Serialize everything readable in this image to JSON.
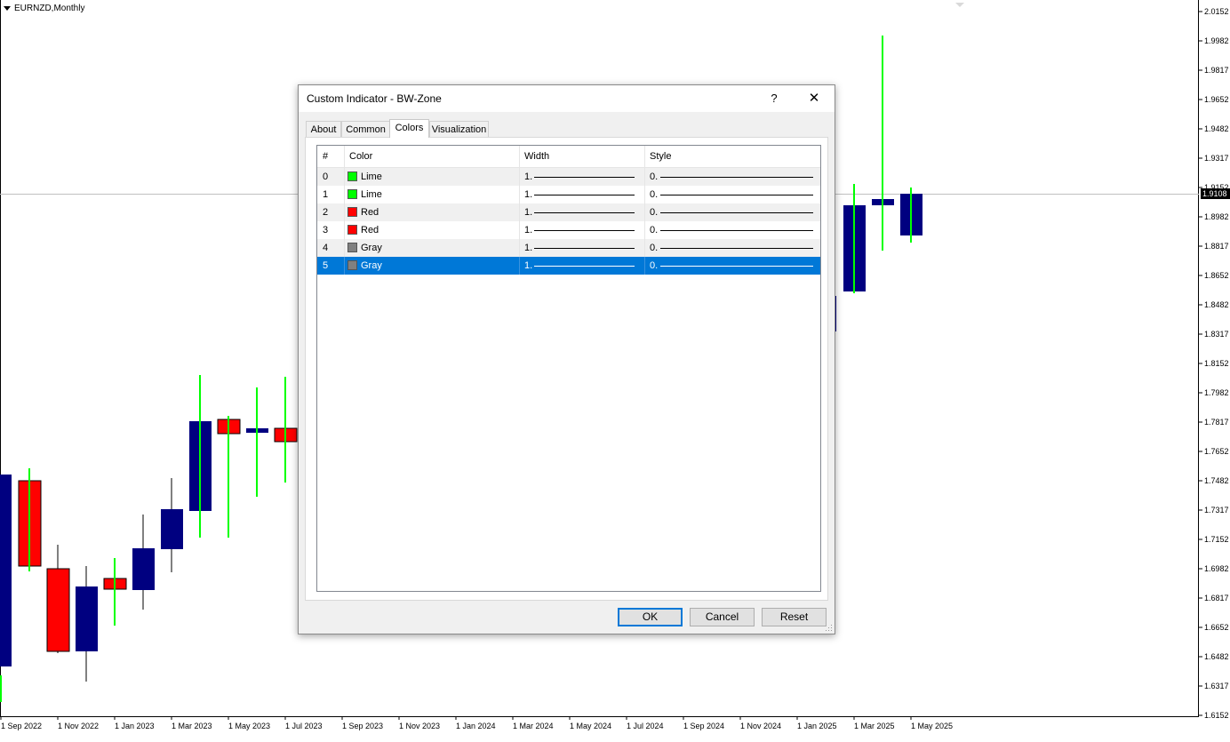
{
  "chart": {
    "symbol": "EURNZD,Monthly",
    "current_price": "1.9108",
    "price_axis": [
      "2.0152",
      "1.9982",
      "1.9817",
      "1.9652",
      "1.9482",
      "1.9317",
      "1.9152",
      "1.8982",
      "1.8817",
      "1.8652",
      "1.8482",
      "1.8317",
      "1.8152",
      "1.7982",
      "1.7817",
      "1.7652",
      "1.7482",
      "1.7317",
      "1.7152",
      "1.6982",
      "1.6817",
      "1.6652",
      "1.6482",
      "1.6317",
      "1.6152"
    ],
    "time_axis": [
      "1 Sep 2022",
      "1 Nov 2022",
      "1 Jan 2023",
      "1 Mar 2023",
      "1 May 2023",
      "1 Jul 2023",
      "1 Sep 2023",
      "1 Nov 2023",
      "1 Jan 2024",
      "1 Mar 2024",
      "1 May 2024",
      "1 Jul 2024",
      "1 Sep 2024",
      "1 Nov 2024",
      "1 Jan 2025",
      "1 Mar 2025",
      "1 May 2025"
    ],
    "colors": {
      "bull": "#000080",
      "bear": "#ff0000",
      "lime": "#00ff00",
      "gray": "#808080",
      "grid_line": "#c0c0c0"
    }
  },
  "dialog": {
    "title": "Custom Indicator - BW-Zone",
    "help_label": "?",
    "close_label": "✕",
    "tabs": [
      "About",
      "Common",
      "Colors",
      "Visualization"
    ],
    "active_tab": "Colors",
    "columns": [
      "#",
      "Color",
      "Width",
      "Style"
    ],
    "rows": [
      {
        "index": "0",
        "color_name": "Lime",
        "color_hex": "#00ff00",
        "width": "1.",
        "style": "0."
      },
      {
        "index": "1",
        "color_name": "Lime",
        "color_hex": "#00ff00",
        "width": "1.",
        "style": "0."
      },
      {
        "index": "2",
        "color_name": "Red",
        "color_hex": "#ff0000",
        "width": "1.",
        "style": "0."
      },
      {
        "index": "3",
        "color_name": "Red",
        "color_hex": "#ff0000",
        "width": "1.",
        "style": "0."
      },
      {
        "index": "4",
        "color_name": "Gray",
        "color_hex": "#808080",
        "width": "1.",
        "style": "0."
      },
      {
        "index": "5",
        "color_name": "Gray",
        "color_hex": "#808080",
        "width": "1.",
        "style": "0."
      }
    ],
    "selected_row": "5",
    "buttons": {
      "ok": "OK",
      "cancel": "Cancel",
      "reset": "Reset"
    }
  }
}
